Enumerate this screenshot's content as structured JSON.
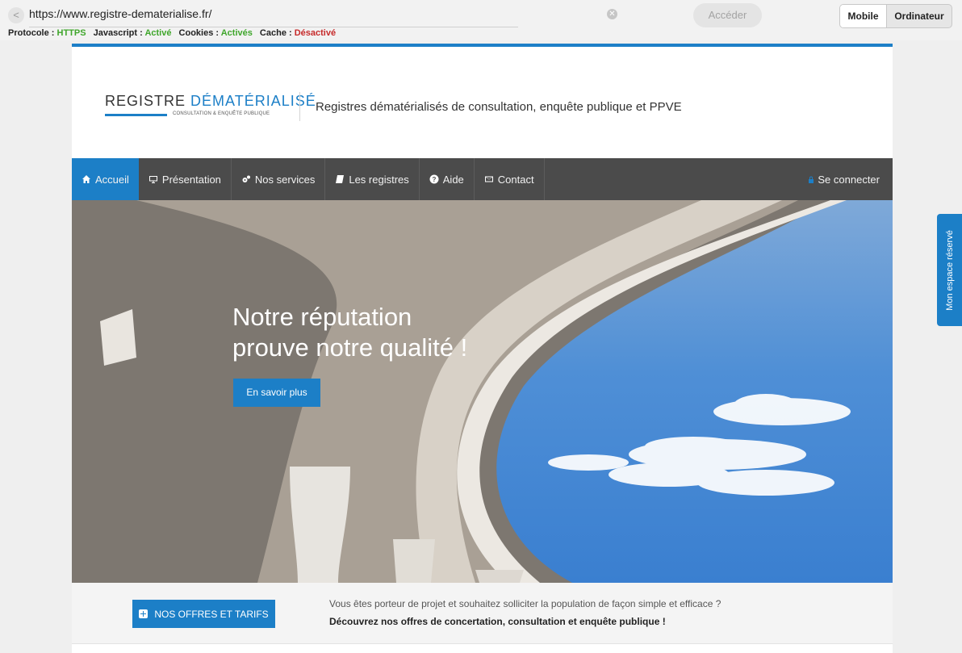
{
  "toolbar": {
    "url": "https://www.registre-dematerialise.fr/",
    "status": {
      "protocol_label": "Protocole :",
      "protocol_value": "HTTPS",
      "javascript_label": "Javascript :",
      "javascript_value": "Activé",
      "cookies_label": "Cookies :",
      "cookies_value": "Activés",
      "cache_label": "Cache :",
      "cache_value": "Désactivé"
    },
    "go_label": "Accéder",
    "modes": [
      "Mobile",
      "Ordinateur"
    ],
    "active_mode": "Mobile"
  },
  "header": {
    "logo_main_left": "REGISTRE",
    "logo_main_right": "DÉMATÉRIALISÉ",
    "logo_sub": "CONSULTATION & ENQUÊTE PUBLIQUE",
    "tagline": "Registres dématérialisés de consultation, enquête publique et PPVE"
  },
  "nav": {
    "items": [
      {
        "label": "Accueil",
        "icon": "home-icon"
      },
      {
        "label": "Présentation",
        "icon": "monitor-icon"
      },
      {
        "label": "Nos services",
        "icon": "cogs-icon"
      },
      {
        "label": "Les registres",
        "icon": "book-icon"
      },
      {
        "label": "Aide",
        "icon": "question-icon"
      },
      {
        "label": "Contact",
        "icon": "envelope-icon"
      }
    ],
    "active": "Accueil",
    "login_label": "Se connecter"
  },
  "hero": {
    "title_line1": "Notre réputation",
    "title_line2": "prouve notre qualité !",
    "button_label": "En savoir plus"
  },
  "offers": {
    "button_label": "NOS OFFRES ET TARIFS",
    "line1": "Vous êtes porteur de projet et souhaitez solliciter la population de façon simple et efficace ?",
    "line2": "Découvrez nos offres de concertation, consultation et enquête publique !"
  },
  "side_tab": {
    "label": "Mon espace réservé"
  },
  "colors": {
    "brand_blue": "#1c7fc7",
    "nav_bg": "#4b4b4b",
    "status_green": "#3fa62b",
    "status_red": "#c62b2b"
  }
}
